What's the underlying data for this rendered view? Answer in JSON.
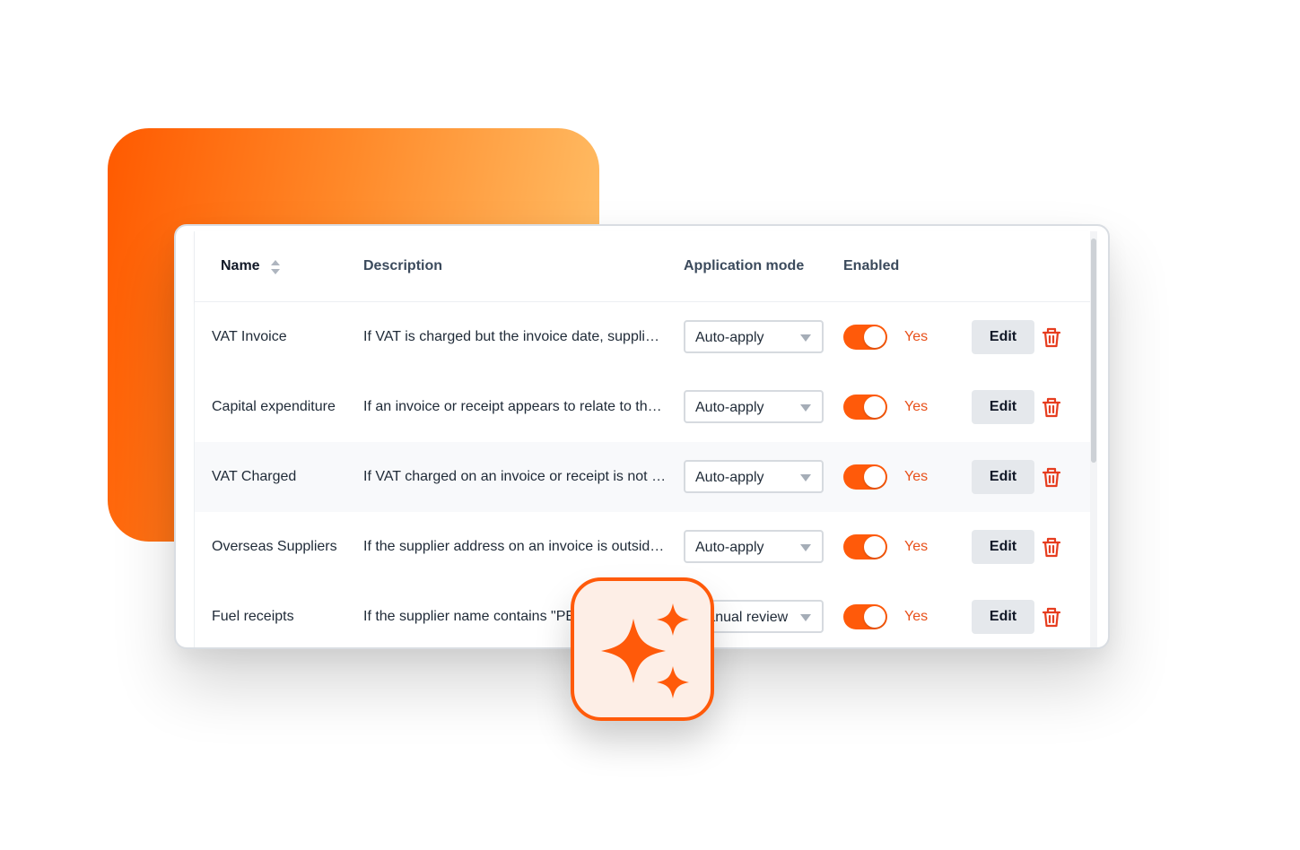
{
  "colors": {
    "accent": "#ff5a0a",
    "yes_text": "#e8501a",
    "gradient_start": "#ff5a00",
    "gradient_end": "#ffc56e"
  },
  "table": {
    "headers": {
      "name": "Name",
      "description": "Description",
      "mode": "Application mode",
      "enabled": "Enabled"
    },
    "sort_icon": "sort-icon",
    "rows": [
      {
        "name": "VAT Invoice",
        "description": "If VAT is charged but the invoice date, supplier details or VAT number are missing",
        "mode": "Auto-apply",
        "enabled": true,
        "enabled_label": "Yes",
        "edit_label": "Edit"
      },
      {
        "name": "Capital expenditure",
        "description": "If an invoice or receipt appears to relate to the purchase of a capital asset",
        "mode": "Auto-apply",
        "enabled": true,
        "enabled_label": "Yes",
        "edit_label": "Edit"
      },
      {
        "name": "VAT Charged",
        "description": "If VAT charged on an invoice or receipt is not equal to the expected rate",
        "mode": "Auto-apply",
        "enabled": true,
        "enabled_label": "Yes",
        "edit_label": "Edit"
      },
      {
        "name": "Overseas Suppliers",
        "description": "If the supplier address on an invoice is outside the UK",
        "mode": "Auto-apply",
        "enabled": true,
        "enabled_label": "Yes",
        "edit_label": "Edit"
      },
      {
        "name": "Fuel receipts",
        "description": "If the supplier name contains \"PE",
        "mode": "Manual review",
        "enabled": true,
        "enabled_label": "Yes",
        "edit_label": "Edit"
      }
    ]
  },
  "badge": {
    "icon": "sparkle-icon"
  }
}
